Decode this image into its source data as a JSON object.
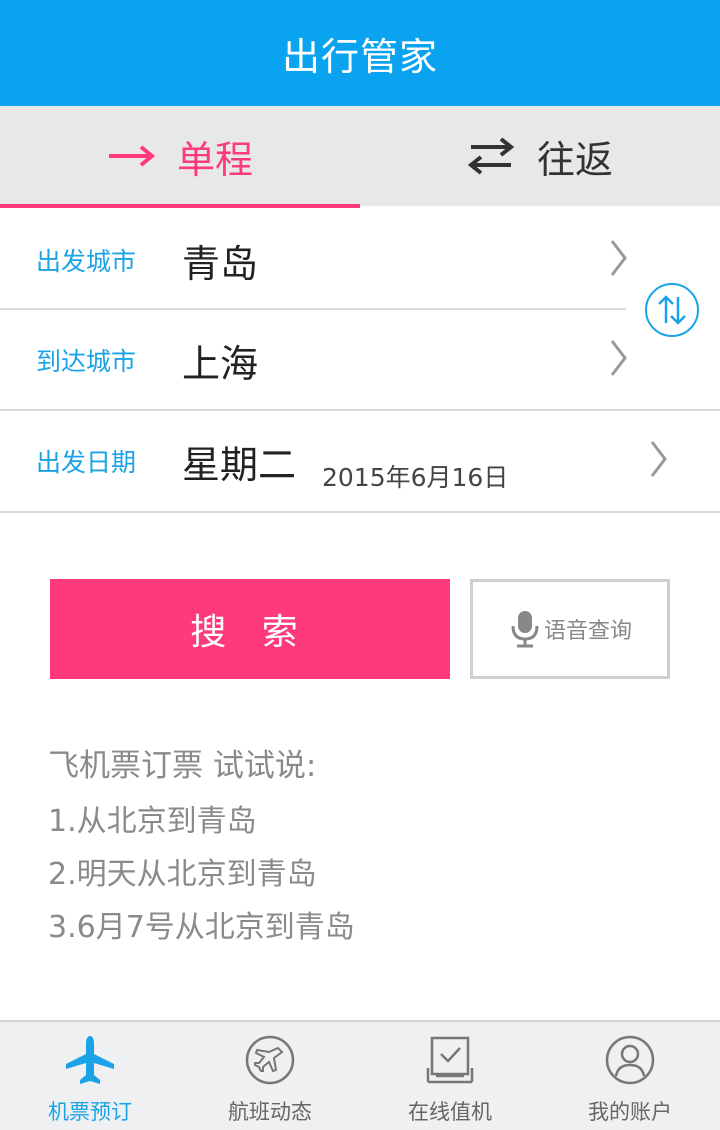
{
  "header": {
    "title": "出行管家"
  },
  "tabs": [
    {
      "label": "单程",
      "icon": "arrow-right-icon",
      "active": true
    },
    {
      "label": "往返",
      "icon": "swap-arrows-icon",
      "active": false
    }
  ],
  "form": {
    "departure": {
      "label": "出发城市",
      "value": "青岛"
    },
    "arrival": {
      "label": "到达城市",
      "value": "上海"
    },
    "date": {
      "label": "出发日期",
      "weekday": "星期二",
      "date": "2015年6月16日"
    }
  },
  "buttons": {
    "search": "搜 索",
    "voice": "语音查询"
  },
  "hints": {
    "title": "飞机票订票 试试说:",
    "lines": [
      "1.从北京到青岛",
      "2.明天从北京到青岛",
      "3.6月7号从北京到青岛"
    ]
  },
  "bottom_nav": [
    {
      "label": "机票预订",
      "icon": "airplane-icon",
      "active": true
    },
    {
      "label": "航班动态",
      "icon": "flight-status-icon",
      "active": false
    },
    {
      "label": "在线值机",
      "icon": "checkin-icon",
      "active": false
    },
    {
      "label": "我的账户",
      "icon": "user-icon",
      "active": false
    }
  ],
  "colors": {
    "header": "#0aa3f0",
    "accent": "#ff3a7a",
    "label": "#1ba3e8"
  }
}
